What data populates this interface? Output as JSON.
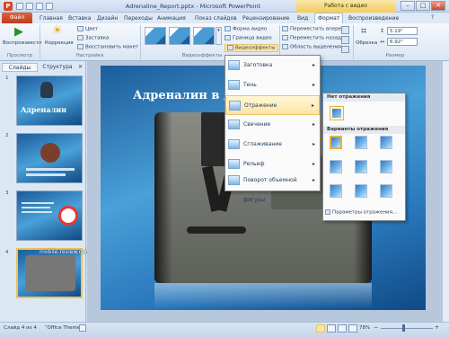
{
  "window": {
    "title": "Adrenaline_Report.pptx - Microsoft PowerPoint",
    "context_header": "Работа с видео",
    "app_icon": "P"
  },
  "tabs": [
    {
      "label": "Файл"
    },
    {
      "label": "Главная"
    },
    {
      "label": "Вставка"
    },
    {
      "label": "Дизайн"
    },
    {
      "label": "Переходы"
    },
    {
      "label": "Анимация"
    },
    {
      "label": "Показ слайдов"
    },
    {
      "label": "Рецензирование"
    },
    {
      "label": "Вид"
    },
    {
      "label": "Формат"
    },
    {
      "label": "Воспроизведение"
    }
  ],
  "ribbon": {
    "preview": {
      "button": "Воспроизвести",
      "group": "Просмотр"
    },
    "adjust": {
      "correction": "Коррекция",
      "color": "Цвет",
      "poster": "Заставка",
      "reset": "Восстановить макет",
      "group": "Настройка"
    },
    "styles": {
      "group": "Видеоэффекты"
    },
    "video_fx": {
      "shape": "Форма видео",
      "border": "Граница видео",
      "effects": "Видеоэффекты"
    },
    "arrange": {
      "forward": "Переместить вперед",
      "backward": "Переместить назад",
      "selection": "Область выделения"
    },
    "size": {
      "crop": "Обрезка",
      "height": "5.19\"",
      "width": "6.92\"",
      "group": "Размер"
    }
  },
  "panel": {
    "tab_slides": "Слайды",
    "tab_outline": "Структура",
    "thumb1_title": "Адреналин",
    "thumbs": [
      "1",
      "2",
      "3",
      "4"
    ]
  },
  "slide": {
    "title": "Адреналин в дей"
  },
  "effects_menu": {
    "items": [
      "Заготовка",
      "Тень",
      "Отражение",
      "Свечение",
      "Сглаживание",
      "Рельеф",
      "Поворот объемной фигуры"
    ]
  },
  "reflection_submenu": {
    "none_header": "Нет отражения",
    "variants_header": "Варианты отражения",
    "options": "Параметры отражения..."
  },
  "watermark": "mobile-review.com",
  "status": {
    "slide": "Слайд 4 из 4",
    "theme": "\"Office Theme\"",
    "zoom": "78%"
  }
}
